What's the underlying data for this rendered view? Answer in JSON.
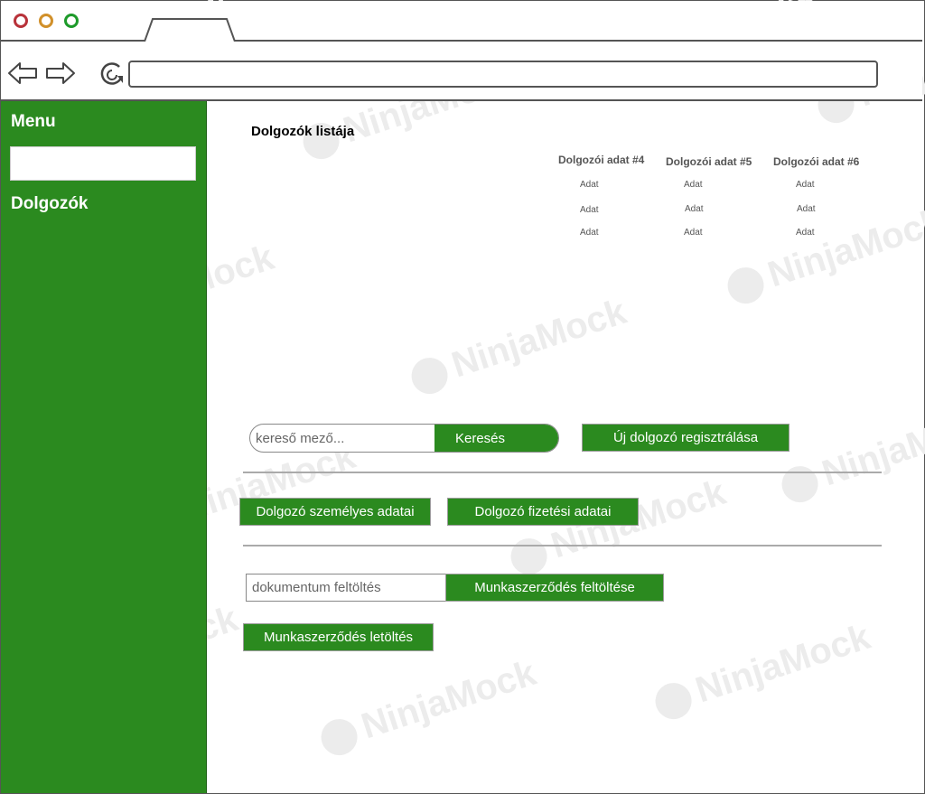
{
  "sidebar": {
    "title": "Menu",
    "items": [
      {
        "label": "Dolgozók"
      }
    ]
  },
  "main": {
    "title": "Dolgozók listája",
    "columns": [
      {
        "header": "Dolgozói adat #4",
        "cells": [
          "Adat",
          "Adat",
          "Adat"
        ]
      },
      {
        "header": "Dolgozói adat #5",
        "cells": [
          "Adat",
          "Adat",
          "Adat"
        ]
      },
      {
        "header": "Dolgozói adat #6",
        "cells": [
          "Adat",
          "Adat",
          "Adat"
        ]
      }
    ],
    "search": {
      "placeholder": "kereső mező...",
      "button": "Keresés"
    },
    "new_employee_button": "Új dolgozó regisztrálása",
    "personal_data_button": "Dolgozó személyes adatai",
    "payment_data_button": "Dolgozó fizetési adatai",
    "document": {
      "placeholder": "dokumentum feltöltés",
      "upload_button": "Munkaszerződés feltöltése"
    },
    "download_button": "Munkaszerződés letöltés"
  },
  "watermark": "NinjaMock",
  "colors": {
    "accent": "#2b8a1f",
    "border": "#555555"
  }
}
